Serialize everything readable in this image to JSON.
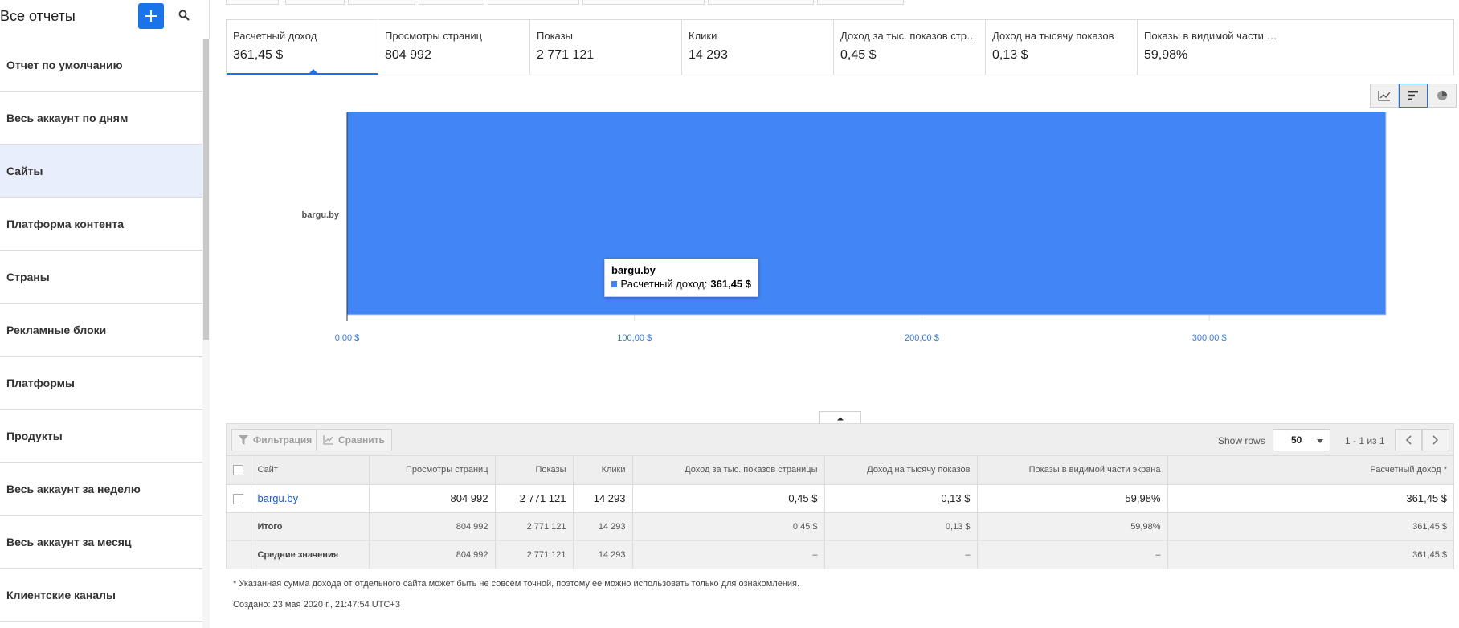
{
  "sidebar": {
    "title": "Все отчеты",
    "items": [
      {
        "label": "Отчет по умолчанию",
        "selected": false
      },
      {
        "label": "Весь аккаунт по дням",
        "selected": false
      },
      {
        "label": "Сайты",
        "selected": true
      },
      {
        "label": "Платформа контента",
        "selected": false
      },
      {
        "label": "Страны",
        "selected": false
      },
      {
        "label": "Рекламные блоки",
        "selected": false
      },
      {
        "label": "Платформы",
        "selected": false
      },
      {
        "label": "Продукты",
        "selected": false
      },
      {
        "label": "Весь аккаунт за неделю",
        "selected": false
      },
      {
        "label": "Весь аккаунт за месяц",
        "selected": false
      },
      {
        "label": "Клиентские каналы",
        "selected": false
      }
    ]
  },
  "metrics": [
    {
      "label": "Расчетный доход",
      "value": "361,45 $",
      "active": true
    },
    {
      "label": "Просмотры страниц",
      "value": "804 992",
      "active": false
    },
    {
      "label": "Показы",
      "value": "2 771 121",
      "active": false
    },
    {
      "label": "Клики",
      "value": "14 293",
      "active": false
    },
    {
      "label": "Доход за тыс. показов страни…",
      "value": "0,45 $",
      "active": false
    },
    {
      "label": "Доход на тысячу показов",
      "value": "0,13 $",
      "active": false
    },
    {
      "label": "Показы в видимой части экрана",
      "value": "59,98%",
      "active": false
    }
  ],
  "chart_data": {
    "type": "bar",
    "orientation": "horizontal",
    "categories": [
      "bargu.by"
    ],
    "series": [
      {
        "name": "Расчетный доход",
        "values": [
          361.45
        ]
      }
    ],
    "x_ticks": [
      0,
      100,
      200,
      300
    ],
    "x_tick_labels": [
      "0,00 $",
      "100,00 $",
      "200,00 $",
      "300,00 $"
    ],
    "xlim": [
      0,
      361.45
    ],
    "grid": true,
    "bar_color": "#4285f4",
    "tooltip": {
      "title": "bargu.by",
      "label": "Расчетный доход:",
      "value": "361,45 $"
    }
  },
  "toolbar": {
    "filter_label": "Фильтрация",
    "compare_label": "Сравнить",
    "show_rows_label": "Show rows",
    "rows_value": "50",
    "pager_text": "1 - 1 из 1"
  },
  "table": {
    "headers": [
      "Сайт",
      "Просмотры страниц",
      "Показы",
      "Клики",
      "Доход за тыс. показов страницы",
      "Доход на тысячу показов",
      "Показы в видимой части экрана",
      "Расчетный доход *"
    ],
    "rows": [
      [
        "bargu.by",
        "804 992",
        "2 771 121",
        "14 293",
        "0,45 $",
        "0,13 $",
        "59,98%",
        "361,45 $"
      ]
    ],
    "totals": [
      "Итого",
      "804 992",
      "2 771 121",
      "14 293",
      "0,45 $",
      "0,13 $",
      "59,98%",
      "361,45 $"
    ],
    "averages": [
      "Средние значения",
      "804 992",
      "2 771 121",
      "14 293",
      "–",
      "–",
      "–",
      "361,45 $"
    ]
  },
  "footer": {
    "note": "* Указанная сумма дохода от отдельного сайта может быть не совсем точной, поэтому ее можно использовать только для ознакомления.",
    "created": "Создано: 23 мая 2020 г., 21:47:54 UTC+3"
  },
  "colors": {
    "accent": "#1a73e8",
    "bar": "#4285f4",
    "link": "#1a5cc7"
  },
  "icons": [
    "add-icon",
    "search-icon",
    "line-chart-icon",
    "bar-chart-icon",
    "pie-chart-icon",
    "filter-icon",
    "compare-icon",
    "chevron-left-icon",
    "chevron-right-icon",
    "chevron-up-icon"
  ]
}
